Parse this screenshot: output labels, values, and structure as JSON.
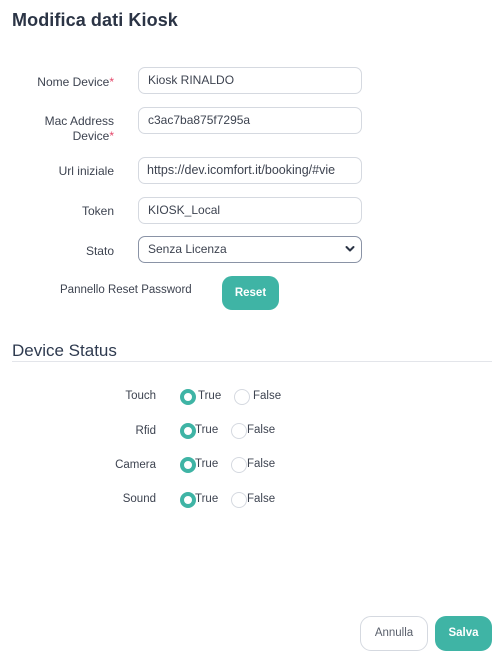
{
  "header": {
    "title": "Modifica dati Kiosk"
  },
  "form": {
    "nome_device": {
      "label": "Nome Device",
      "required_mark": "*",
      "value": "Kiosk RINALDO"
    },
    "mac_address": {
      "label_line1": "Mac Address",
      "label_line2": "Device",
      "required_mark": "*",
      "value": "c3ac7ba875f7295a"
    },
    "url_iniziale": {
      "label": "Url iniziale",
      "value": "https://dev.icomfort.it/booking/#vie"
    },
    "token": {
      "label": "Token",
      "value": "KIOSK_Local"
    },
    "stato": {
      "label": "Stato",
      "selected": "Senza Licenza"
    },
    "reset": {
      "label": "Pannello Reset Password",
      "button": "Reset"
    }
  },
  "device_status": {
    "title": "Device Status",
    "true_label": "True",
    "false_label": "False",
    "items": [
      {
        "label": "Touch",
        "value": true
      },
      {
        "label": "Rfid",
        "value": true
      },
      {
        "label": "Camera",
        "value": true
      },
      {
        "label": "Sound",
        "value": true
      }
    ]
  },
  "footer": {
    "cancel": "Annulla",
    "save": "Salva"
  },
  "colors": {
    "accent": "#3fb4a5",
    "required": "#e4476a"
  }
}
